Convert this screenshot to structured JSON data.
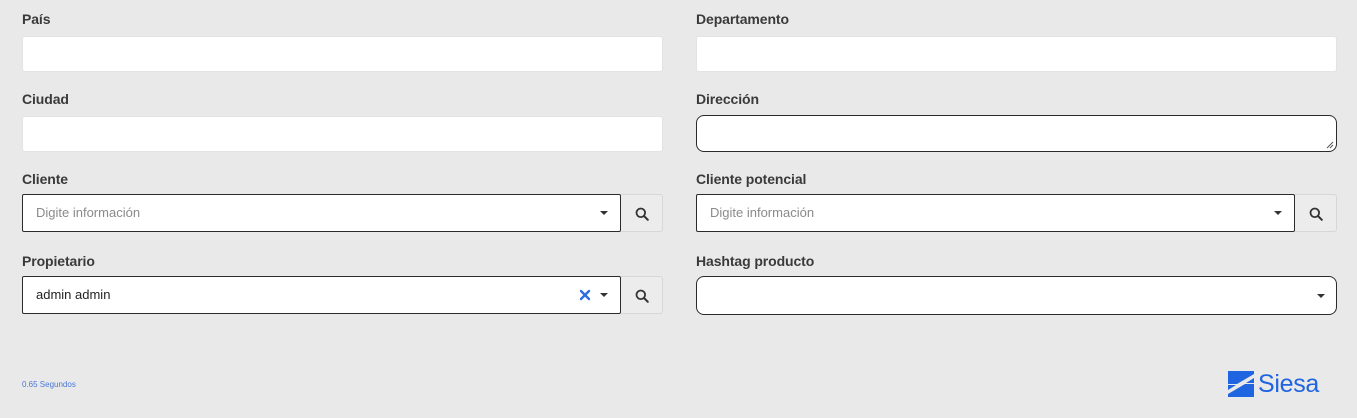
{
  "form": {
    "pais": {
      "label": "País",
      "value": ""
    },
    "departamento": {
      "label": "Departamento",
      "value": ""
    },
    "ciudad": {
      "label": "Ciudad",
      "value": ""
    },
    "direccion": {
      "label": "Dirección",
      "value": ""
    },
    "cliente": {
      "label": "Cliente",
      "placeholder": "Digite información"
    },
    "cliente_potencial": {
      "label": "Cliente potencial",
      "placeholder": "Digite información"
    },
    "propietario": {
      "label": "Propietario",
      "value": "admin admin"
    },
    "hashtag_producto": {
      "label": "Hashtag producto",
      "value": ""
    }
  },
  "footer": {
    "timing": "0.65 Segundos",
    "logo_text": "Siesa"
  },
  "colors": {
    "background": "#e9e9e9",
    "brand_blue": "#1f64e0",
    "clear_icon": "#2f6fdc"
  },
  "icons": {
    "search": "magnifier-icon",
    "dropdown": "caret-down-icon",
    "clear": "x-icon",
    "logo": "siesa-logo-mark"
  }
}
